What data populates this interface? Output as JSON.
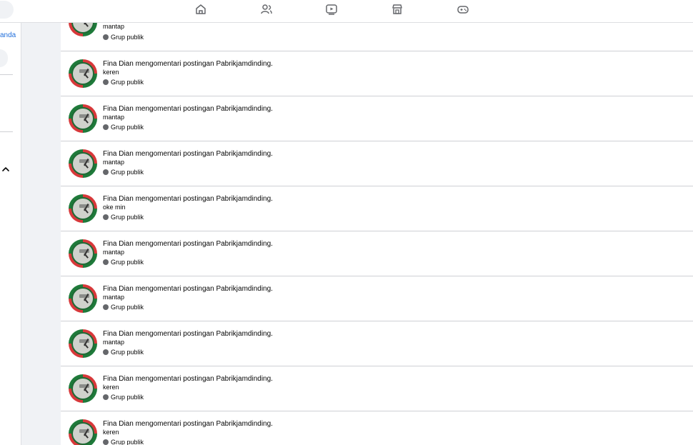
{
  "topbar": {
    "nav": [
      {
        "name": "home-icon"
      },
      {
        "name": "friends-icon"
      },
      {
        "name": "watch-icon"
      },
      {
        "name": "marketplace-icon"
      },
      {
        "name": "gaming-icon"
      }
    ]
  },
  "sidebar": {
    "link_label": "anda",
    "collapse_icon": "chevron-up-icon"
  },
  "feed": {
    "top_item": {
      "comment": "mantap",
      "meta": "Grup publik"
    },
    "items": [
      {
        "actor": "Fina Dian",
        "action": "mengomentari postingan",
        "target": "Pabrikjamdinding.",
        "comment": "keren",
        "meta": "Grup publik"
      },
      {
        "actor": "Fina Dian",
        "action": "mengomentari postingan",
        "target": "Pabrikjamdinding.",
        "comment": "mantap",
        "meta": "Grup publik"
      },
      {
        "actor": "Fina Dian",
        "action": "mengomentari postingan",
        "target": "Pabrikjamdinding.",
        "comment": "mantap",
        "meta": "Grup publik"
      },
      {
        "actor": "Fina Dian",
        "action": "mengomentari postingan",
        "target": "Pabrikjamdinding.",
        "comment": "oke min",
        "meta": "Grup publik"
      },
      {
        "actor": "Fina Dian",
        "action": "mengomentari postingan",
        "target": "Pabrikjamdinding.",
        "comment": "mantap",
        "meta": "Grup publik"
      },
      {
        "actor": "Fina Dian",
        "action": "mengomentari postingan",
        "target": "Pabrikjamdinding.",
        "comment": "mantap",
        "meta": "Grup publik"
      },
      {
        "actor": "Fina Dian",
        "action": "mengomentari postingan",
        "target": "Pabrikjamdinding.",
        "comment": "mantap",
        "meta": "Grup publik"
      },
      {
        "actor": "Fina Dian",
        "action": "mengomentari postingan",
        "target": "Pabrikjamdinding.",
        "comment": "keren",
        "meta": "Grup publik"
      },
      {
        "actor": "Fina Dian",
        "action": "mengomentari postingan",
        "target": "Pabrikjamdinding.",
        "comment": "keren",
        "meta": "Grup publik"
      }
    ]
  }
}
